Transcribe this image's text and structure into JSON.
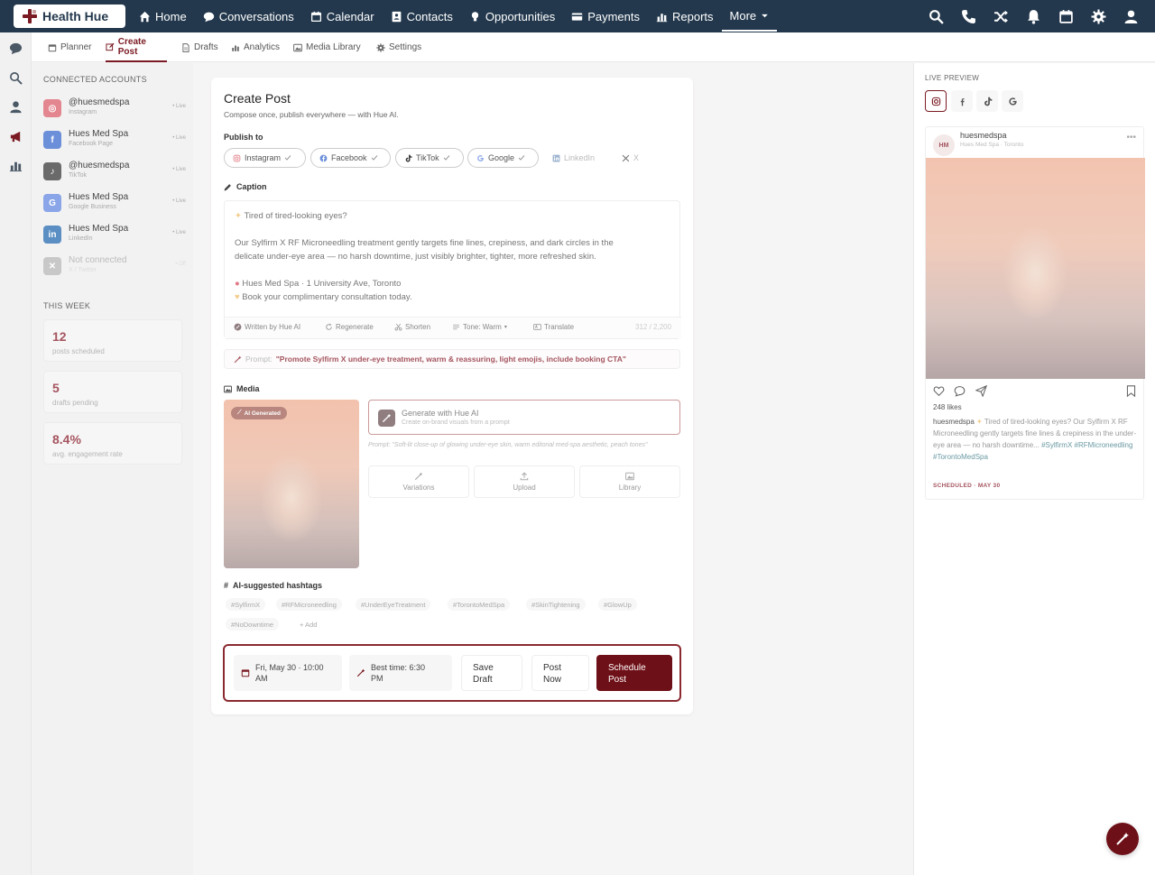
{
  "app": {
    "brand": "Health Hue",
    "accent_color": "#7a1a22",
    "nav_bg_color": "#23384d"
  },
  "topnav": {
    "items": [
      {
        "label": "Home",
        "icon": "home-icon"
      },
      {
        "label": "Conversations",
        "icon": "chat-icon"
      },
      {
        "label": "Calendar",
        "icon": "calendar-icon"
      },
      {
        "label": "Contacts",
        "icon": "contacts-icon"
      },
      {
        "label": "Opportunities",
        "icon": "lightbulb-icon"
      },
      {
        "label": "Payments",
        "icon": "card-icon"
      },
      {
        "label": "Reports",
        "icon": "bar-chart-icon"
      }
    ],
    "more_label": "More",
    "right_icons": [
      "search-icon",
      "phone-icon",
      "shuffle-icon",
      "bell-icon",
      "calendar-icon",
      "gear-icon",
      "user-icon"
    ]
  },
  "subnav": {
    "items": [
      {
        "label": "Planner",
        "icon": "calendar-icon"
      },
      {
        "label": "Create Post",
        "icon": "edit-icon",
        "active": true
      },
      {
        "label": "Drafts",
        "icon": "document-icon"
      },
      {
        "label": "Analytics",
        "icon": "bar-chart-icon"
      },
      {
        "label": "Media Library",
        "icon": "image-icon"
      },
      {
        "label": "Settings",
        "icon": "gear-icon"
      }
    ]
  },
  "accounts": {
    "title": "CONNECTED ACCOUNTS",
    "items": [
      {
        "name": "@huesmedspa",
        "platform": "Instagram",
        "status": "• Live",
        "icon": "instagram-icon",
        "color": "#e3868f",
        "glyph": "◎"
      },
      {
        "name": "Hues Med Spa",
        "platform": "Facebook Page",
        "status": "• Live",
        "icon": "facebook-icon",
        "color": "#6b8fd9",
        "glyph": "f"
      },
      {
        "name": "@huesmedspa",
        "platform": "TikTok",
        "status": "• Live",
        "icon": "tiktok-icon",
        "color": "#6a6a6a",
        "glyph": "♪"
      },
      {
        "name": "Hues Med Spa",
        "platform": "Google Business",
        "status": "• Live",
        "icon": "google-icon",
        "color": "#8aa6e8",
        "glyph": "G"
      },
      {
        "name": "Hues Med Spa",
        "platform": "LinkedIn",
        "status": "• Live",
        "icon": "linkedin-icon",
        "color": "#5b8fc4",
        "glyph": "in"
      },
      {
        "name": "Not connected",
        "platform": "X / Twitter",
        "status": "• Off",
        "icon": "x-icon",
        "color": "#c8c8c8",
        "glyph": "✕"
      }
    ]
  },
  "week": {
    "title": "THIS WEEK",
    "stats": [
      {
        "value": "12",
        "label": "posts scheduled"
      },
      {
        "value": "5",
        "label": "drafts pending"
      },
      {
        "value": "8.4%",
        "label": "avg. engagement rate"
      }
    ]
  },
  "create": {
    "title": "Create Post",
    "subtitle": "Compose once, publish everywhere — with Hue AI.",
    "publish_to": "Publish to",
    "channels": [
      {
        "label": "Instagram",
        "selected": true
      },
      {
        "label": "Facebook",
        "selected": true
      },
      {
        "label": "TikTok",
        "selected": true
      },
      {
        "label": "Google",
        "selected": true
      },
      {
        "label": "LinkedIn",
        "selected": false
      },
      {
        "label": "X",
        "selected": false
      }
    ],
    "caption_label": "Caption",
    "caption": {
      "line1": "Tired of tired-looking eyes?",
      "line2": "Our Sylfirm X RF Microneedling treatment gently targets fine lines, crepiness, and dark circles in the",
      "line3": "delicate under-eye area — no harsh downtime, just visibly brighter, tighter, more refreshed skin.",
      "line4": "Hues Med Spa · 1 University Ave, Toronto",
      "line5": "Book your complimentary consultation today."
    },
    "tools": {
      "written": "Written by Hue AI",
      "regenerate": "Regenerate",
      "shorten": "Shorten",
      "tone": "Tone: Warm",
      "translate": "Translate",
      "count": "312 / 2,200"
    },
    "prompt_label": "Prompt:",
    "prompt_text": "\"Promote Sylfirm X under-eye treatment, warm & reassuring, light emojis, include booking CTA\"",
    "media_label": "Media",
    "ai_badge": "AI Generated",
    "gen_title": "Generate with Hue AI",
    "gen_sub": "Create on-brand visuals from a prompt",
    "gen_prompt": "Prompt: \"Soft-lit close-up of glowing under-eye skin, warm editorial med-spa aesthetic, peach tones\"",
    "media_buttons": [
      "Variations",
      "Upload",
      "Library"
    ],
    "hashtags_label": "AI-suggested hashtags",
    "hashtags": [
      "#SylfirmX",
      "#RFMicroneedling",
      "#UnderEyeTreatment",
      "#TorontoMedSpa",
      "#SkinTightening",
      "#GlowUp",
      "#NoDowntime"
    ],
    "add_tag": "+ Add",
    "schedule_date": "Fri, May 30 · 10:00 AM",
    "best_time": "Best time: 6:30 PM",
    "save_draft": "Save Draft",
    "post_now": "Post Now",
    "schedule_post": "Schedule Post"
  },
  "preview": {
    "title": "LIVE PREVIEW",
    "avatar": "HM",
    "username": "huesmedspa",
    "location": "Hues Med Spa · Toronto",
    "likes": "248 likes",
    "cap_user": "huesmedspa",
    "cap_text": " Tired of tired-looking eyes? Our Sylfirm X RF Microneedling gently targets fine lines & crepiness in the under-eye area — no harsh downtime... ",
    "cap_tags": "#SylfirmX #RFMicroneedling #TorontoMedSpa",
    "scheduled": "SCHEDULED · MAY 30"
  }
}
